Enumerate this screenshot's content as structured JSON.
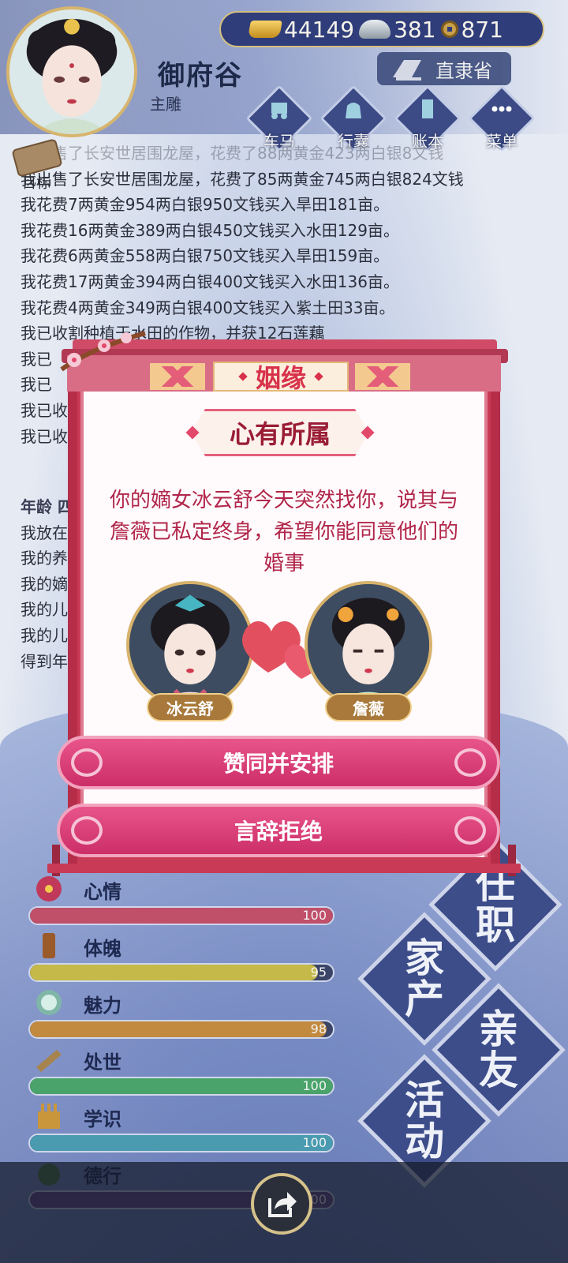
{
  "header": {
    "player_name": "御府谷",
    "player_role": "主雕",
    "province": "直隶省",
    "currency": {
      "gold": "44149",
      "silver": "381",
      "coins": "871"
    },
    "nav": [
      {
        "label": "车马",
        "icon": "carriage-icon"
      },
      {
        "label": "行囊",
        "icon": "bag-icon"
      },
      {
        "label": "账本",
        "icon": "ledger-icon"
      },
      {
        "label": "菜单",
        "icon": "menu-icon"
      }
    ],
    "goal_label": "目标"
  },
  "log": {
    "lines": [
      "我出售了长安世居围龙屋，花费了88两黄金423两白银8文钱",
      "我出售了长安世居围龙屋，花费了85两黄金745两白银824文钱",
      "我花费7两黄金954两白银950文钱买入旱田181亩。",
      "我花费16两黄金389两白银450文钱买入水田129亩。",
      "我花费6两黄金558两白银750文钱买入旱田159亩。",
      "我花费17两黄金394两白银400文钱买入水田136亩。",
      "我花费4两黄金349两白银400文钱买入紫土田33亩。",
      "我已收割种植于水田的作物，并获12石莲藕",
      "我已",
      "我已",
      "我已收",
      "我已收"
    ],
    "age_label": "年龄 四",
    "lines2": [
      "我放在",
      "我的养",
      "我的嫡",
      "我的儿",
      "我的儿",
      "得到年"
    ]
  },
  "stats": [
    {
      "name": "心情",
      "value": "100",
      "level": 1.0,
      "color": "#c0506a",
      "icon": "flower-icon"
    },
    {
      "name": "体魄",
      "value": "95",
      "level": 0.95,
      "color": "#c5b94a",
      "icon": "strength-icon"
    },
    {
      "name": "魅力",
      "value": "98",
      "level": 0.98,
      "color": "#c28a3f",
      "icon": "mirror-icon"
    },
    {
      "name": "处世",
      "value": "100",
      "level": 1.0,
      "color": "#4aa36a",
      "icon": "tools-icon"
    },
    {
      "name": "学识",
      "value": "100",
      "level": 1.0,
      "color": "#4a9bb0",
      "icon": "books-icon"
    },
    {
      "name": "德行",
      "value": "100",
      "level": 1.0,
      "color": "#6a4a8a",
      "icon": "virtue-icon"
    }
  ],
  "side_menu": [
    {
      "label": "任职",
      "chars": [
        "任",
        "职"
      ]
    },
    {
      "label": "家产",
      "chars": [
        "家",
        "产"
      ]
    },
    {
      "label": "亲友",
      "chars": [
        "亲",
        "友"
      ]
    },
    {
      "label": "活动",
      "chars": [
        "活",
        "动"
      ]
    }
  ],
  "modal": {
    "title": "姻缘",
    "subtitle": "心有所属",
    "message": "你的嫡女冰云舒今天突然找你，说其与詹薇已私定终身，希望你能同意他们的婚事",
    "left_name": "冰云舒",
    "right_name": "詹薇",
    "accept_label": "赞同并安排",
    "reject_label": "言辞拒绝"
  },
  "colors": {
    "modal_primary": "#c83a56",
    "button": "#d93c74",
    "text_red": "#b1264a"
  }
}
